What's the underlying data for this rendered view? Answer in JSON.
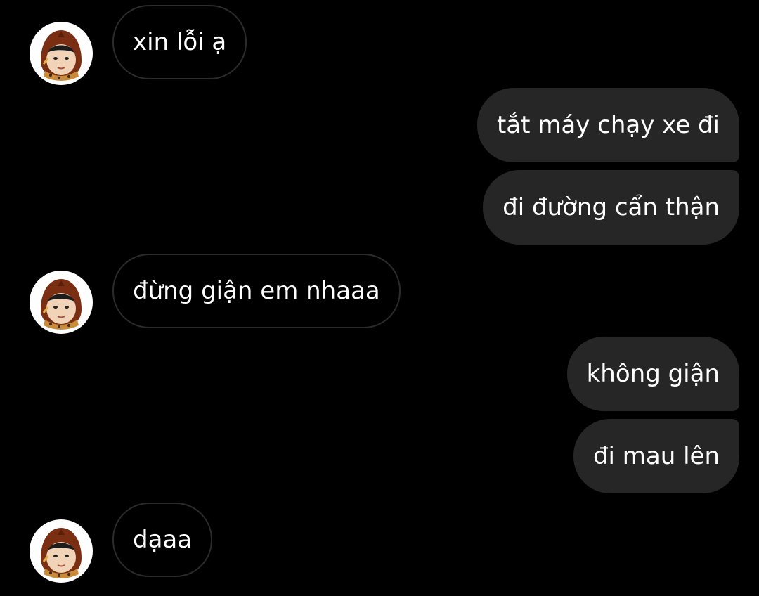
{
  "conversation": {
    "messages": [
      {
        "side": "received",
        "text": "xin lỗi ạ"
      },
      {
        "side": "sent",
        "text": "tắt máy chạy xe đi"
      },
      {
        "side": "sent",
        "text": "đi đường cẩn thận"
      },
      {
        "side": "received",
        "text": "đừng giận em nhaaa"
      },
      {
        "side": "sent",
        "text": "không giận"
      },
      {
        "side": "sent",
        "text": "đi mau lên"
      },
      {
        "side": "received",
        "text": "dạaa"
      }
    ]
  },
  "colors": {
    "background": "#000000",
    "sent_bubble": "#262626",
    "received_border": "#2b2b2b",
    "text": "#ffffff"
  },
  "icons": {
    "contact_avatar": "avatar-hooded-face-icon"
  }
}
